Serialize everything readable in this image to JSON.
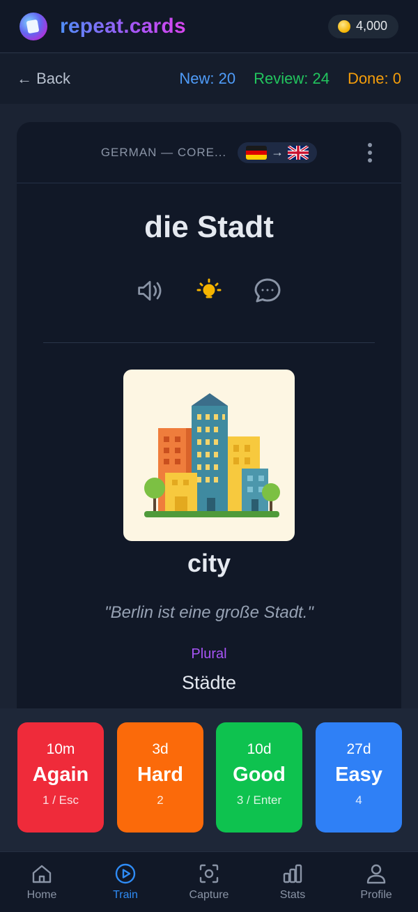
{
  "header": {
    "brand": "repeat.cards",
    "coins": "4,000",
    "icons": {
      "logo": "cards-logo",
      "coin": "coin-icon"
    }
  },
  "session": {
    "back_label": "← Back",
    "new_label": "New: 20",
    "review_label": "Review: 24",
    "done_label": "Done: 0"
  },
  "card": {
    "deck_name": "GERMAN — CORE...",
    "source_lang": "German flag",
    "target_lang": "UK flag",
    "arrow": "→",
    "word": "die Stadt",
    "translation": "city",
    "example": "\"Berlin ist eine große Stadt.\"",
    "plural_label": "Plural",
    "plural_value": "Städte",
    "tools": [
      "speaker-icon",
      "lightbulb-icon",
      "chat-icon"
    ],
    "image": "city-illustration"
  },
  "answers": [
    {
      "time": "10m",
      "label": "Again",
      "key": "1 / Esc",
      "color": "#ef2b3a"
    },
    {
      "time": "3d",
      "label": "Hard",
      "key": "2",
      "color": "#fb6a0a"
    },
    {
      "time": "10d",
      "label": "Good",
      "key": "3 / Enter",
      "color": "#0ec24f"
    },
    {
      "time": "27d",
      "label": "Easy",
      "key": "4",
      "color": "#2f80f6"
    }
  ],
  "nav": {
    "items": [
      {
        "label": "Home",
        "icon": "home-icon"
      },
      {
        "label": "Train",
        "icon": "play-circle-icon",
        "active": true
      },
      {
        "label": "Capture",
        "icon": "camera-scan-icon"
      },
      {
        "label": "Stats",
        "icon": "bar-chart-icon"
      },
      {
        "label": "Profile",
        "icon": "user-icon"
      }
    ]
  },
  "colors": {
    "accent": "#2f8cf6",
    "new": "#4f9cf9",
    "review": "#22c55e",
    "done": "#f59e0b",
    "plural": "#a855f7"
  }
}
